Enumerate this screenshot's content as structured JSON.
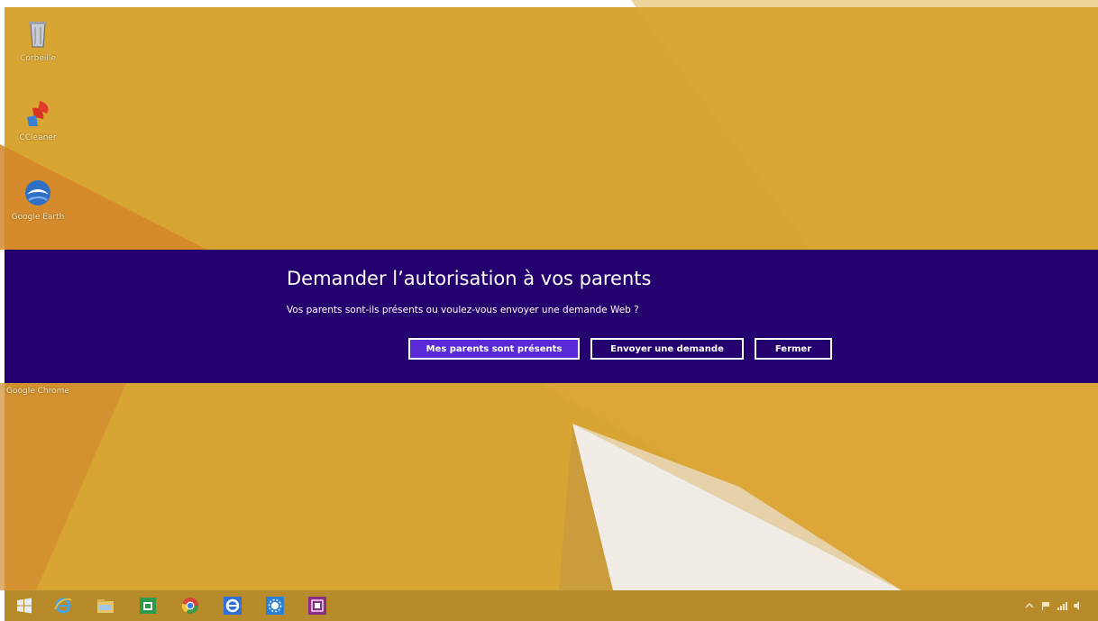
{
  "desktop": {
    "icons": [
      {
        "label": "Corbeille"
      },
      {
        "label": "CCleaner"
      },
      {
        "label": "Google Earth"
      },
      {
        "label": "Google Chrome"
      }
    ]
  },
  "dialog": {
    "title": "Demander l’autorisation à vos parents",
    "message": "Vos parents sont-ils présents ou voulez-vous envoyer une demande Web ?",
    "buttons": {
      "parents_present": "Mes parents sont présents",
      "send_request": "Envoyer une demande",
      "close": "Fermer"
    }
  },
  "taskbar": {
    "items": [
      "start-icon",
      "internet-explorer-icon",
      "file-explorer-icon",
      "store-icon",
      "chrome-icon",
      "internet-explorer-icon",
      "control-panel-icon",
      "onenote-icon"
    ]
  },
  "colors": {
    "wallpaper": "#d9a532",
    "dialog_background": "#24006f",
    "primary_button": "#5a2ad6"
  }
}
